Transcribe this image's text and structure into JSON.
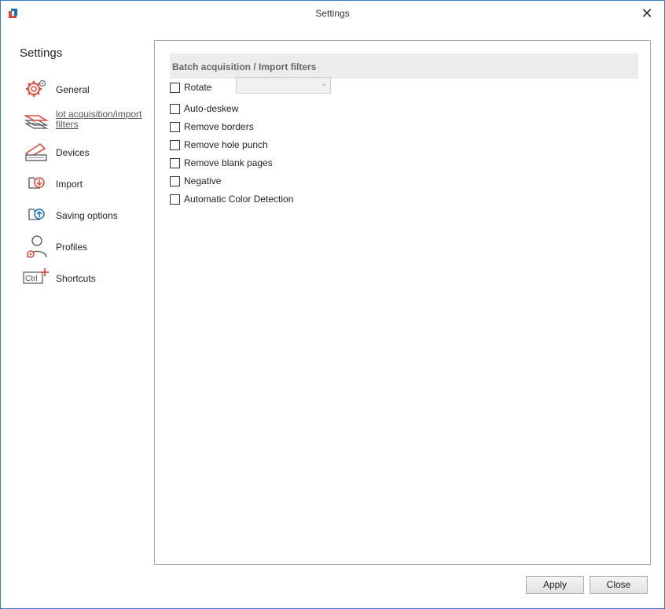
{
  "window": {
    "title": "Settings"
  },
  "sidebar": {
    "heading": "Settings",
    "items": [
      {
        "label": "General",
        "icon": "gears-icon"
      },
      {
        "label": "lot acquisition/import filters",
        "icon": "page-stack-icon"
      },
      {
        "label": "Devices",
        "icon": "scanner-icon"
      },
      {
        "label": "Import",
        "icon": "import-icon"
      },
      {
        "label": "Saving options",
        "icon": "saving-icon"
      },
      {
        "label": "Profiles",
        "icon": "profile-icon"
      },
      {
        "label": "Shortcuts",
        "icon": "ctrl-shortcut-icon"
      }
    ]
  },
  "panel": {
    "section_title": "Batch acquisition / Import filters",
    "options": [
      {
        "label": "Rotate",
        "checked": false
      },
      {
        "label": "Auto-deskew",
        "checked": false
      },
      {
        "label": "Remove borders",
        "checked": false
      },
      {
        "label": "Remove hole punch",
        "checked": false
      },
      {
        "label": "Remove blank pages",
        "checked": false
      },
      {
        "label": "Negative",
        "checked": false
      },
      {
        "label": "Automatic Color Detection",
        "checked": false
      }
    ],
    "rotate_value": ""
  },
  "footer": {
    "apply_label": "Apply",
    "close_label": "Close"
  },
  "colors": {
    "accent": "#e04a3a",
    "blue": "#1a6fc2",
    "border": "#3a7ac8"
  }
}
